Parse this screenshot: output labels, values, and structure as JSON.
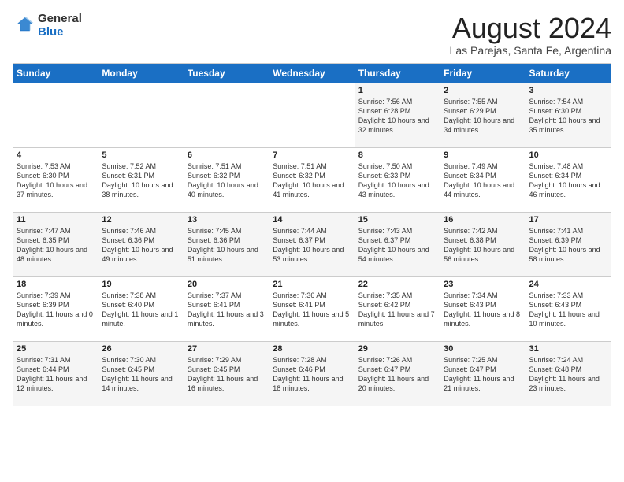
{
  "logo": {
    "general": "General",
    "blue": "Blue"
  },
  "title": "August 2024",
  "location": "Las Parejas, Santa Fe, Argentina",
  "weekdays": [
    "Sunday",
    "Monday",
    "Tuesday",
    "Wednesday",
    "Thursday",
    "Friday",
    "Saturday"
  ],
  "weeks": [
    [
      {
        "day": "",
        "info": ""
      },
      {
        "day": "",
        "info": ""
      },
      {
        "day": "",
        "info": ""
      },
      {
        "day": "",
        "info": ""
      },
      {
        "day": "1",
        "info": "Sunrise: 7:56 AM\nSunset: 6:28 PM\nDaylight: 10 hours\nand 32 minutes."
      },
      {
        "day": "2",
        "info": "Sunrise: 7:55 AM\nSunset: 6:29 PM\nDaylight: 10 hours\nand 34 minutes."
      },
      {
        "day": "3",
        "info": "Sunrise: 7:54 AM\nSunset: 6:30 PM\nDaylight: 10 hours\nand 35 minutes."
      }
    ],
    [
      {
        "day": "4",
        "info": "Sunrise: 7:53 AM\nSunset: 6:30 PM\nDaylight: 10 hours\nand 37 minutes."
      },
      {
        "day": "5",
        "info": "Sunrise: 7:52 AM\nSunset: 6:31 PM\nDaylight: 10 hours\nand 38 minutes."
      },
      {
        "day": "6",
        "info": "Sunrise: 7:51 AM\nSunset: 6:32 PM\nDaylight: 10 hours\nand 40 minutes."
      },
      {
        "day": "7",
        "info": "Sunrise: 7:51 AM\nSunset: 6:32 PM\nDaylight: 10 hours\nand 41 minutes."
      },
      {
        "day": "8",
        "info": "Sunrise: 7:50 AM\nSunset: 6:33 PM\nDaylight: 10 hours\nand 43 minutes."
      },
      {
        "day": "9",
        "info": "Sunrise: 7:49 AM\nSunset: 6:34 PM\nDaylight: 10 hours\nand 44 minutes."
      },
      {
        "day": "10",
        "info": "Sunrise: 7:48 AM\nSunset: 6:34 PM\nDaylight: 10 hours\nand 46 minutes."
      }
    ],
    [
      {
        "day": "11",
        "info": "Sunrise: 7:47 AM\nSunset: 6:35 PM\nDaylight: 10 hours\nand 48 minutes."
      },
      {
        "day": "12",
        "info": "Sunrise: 7:46 AM\nSunset: 6:36 PM\nDaylight: 10 hours\nand 49 minutes."
      },
      {
        "day": "13",
        "info": "Sunrise: 7:45 AM\nSunset: 6:36 PM\nDaylight: 10 hours\nand 51 minutes."
      },
      {
        "day": "14",
        "info": "Sunrise: 7:44 AM\nSunset: 6:37 PM\nDaylight: 10 hours\nand 53 minutes."
      },
      {
        "day": "15",
        "info": "Sunrise: 7:43 AM\nSunset: 6:37 PM\nDaylight: 10 hours\nand 54 minutes."
      },
      {
        "day": "16",
        "info": "Sunrise: 7:42 AM\nSunset: 6:38 PM\nDaylight: 10 hours\nand 56 minutes."
      },
      {
        "day": "17",
        "info": "Sunrise: 7:41 AM\nSunset: 6:39 PM\nDaylight: 10 hours\nand 58 minutes."
      }
    ],
    [
      {
        "day": "18",
        "info": "Sunrise: 7:39 AM\nSunset: 6:39 PM\nDaylight: 11 hours\nand 0 minutes."
      },
      {
        "day": "19",
        "info": "Sunrise: 7:38 AM\nSunset: 6:40 PM\nDaylight: 11 hours\nand 1 minute."
      },
      {
        "day": "20",
        "info": "Sunrise: 7:37 AM\nSunset: 6:41 PM\nDaylight: 11 hours\nand 3 minutes."
      },
      {
        "day": "21",
        "info": "Sunrise: 7:36 AM\nSunset: 6:41 PM\nDaylight: 11 hours\nand 5 minutes."
      },
      {
        "day": "22",
        "info": "Sunrise: 7:35 AM\nSunset: 6:42 PM\nDaylight: 11 hours\nand 7 minutes."
      },
      {
        "day": "23",
        "info": "Sunrise: 7:34 AM\nSunset: 6:43 PM\nDaylight: 11 hours\nand 8 minutes."
      },
      {
        "day": "24",
        "info": "Sunrise: 7:33 AM\nSunset: 6:43 PM\nDaylight: 11 hours\nand 10 minutes."
      }
    ],
    [
      {
        "day": "25",
        "info": "Sunrise: 7:31 AM\nSunset: 6:44 PM\nDaylight: 11 hours\nand 12 minutes."
      },
      {
        "day": "26",
        "info": "Sunrise: 7:30 AM\nSunset: 6:45 PM\nDaylight: 11 hours\nand 14 minutes."
      },
      {
        "day": "27",
        "info": "Sunrise: 7:29 AM\nSunset: 6:45 PM\nDaylight: 11 hours\nand 16 minutes."
      },
      {
        "day": "28",
        "info": "Sunrise: 7:28 AM\nSunset: 6:46 PM\nDaylight: 11 hours\nand 18 minutes."
      },
      {
        "day": "29",
        "info": "Sunrise: 7:26 AM\nSunset: 6:47 PM\nDaylight: 11 hours\nand 20 minutes."
      },
      {
        "day": "30",
        "info": "Sunrise: 7:25 AM\nSunset: 6:47 PM\nDaylight: 11 hours\nand 21 minutes."
      },
      {
        "day": "31",
        "info": "Sunrise: 7:24 AM\nSunset: 6:48 PM\nDaylight: 11 hours\nand 23 minutes."
      }
    ]
  ]
}
